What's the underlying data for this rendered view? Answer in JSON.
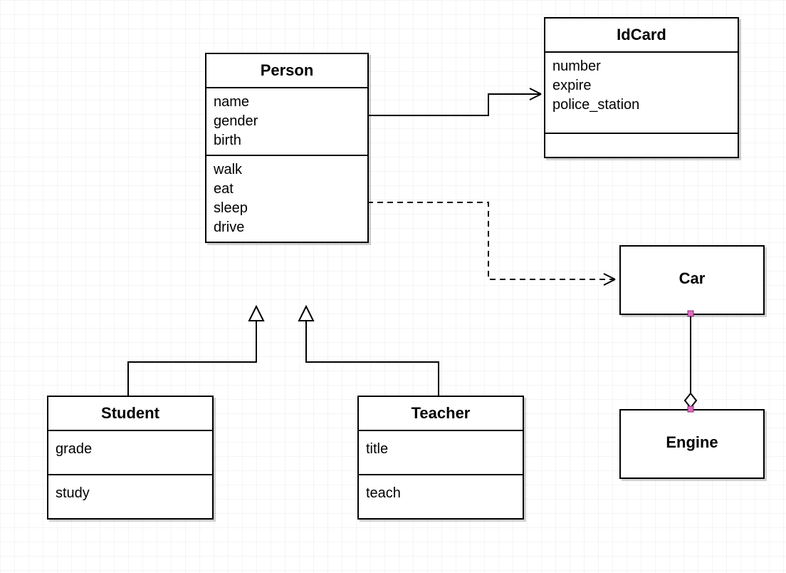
{
  "diagram": {
    "classes": {
      "person": {
        "name": "Person",
        "attributes": [
          "name",
          "gender",
          "birth"
        ],
        "methods": [
          "walk",
          "eat",
          "sleep",
          "drive"
        ]
      },
      "idcard": {
        "name": "IdCard",
        "attributes": [
          "number",
          "expire",
          "police_station"
        ],
        "methods": []
      },
      "student": {
        "name": "Student",
        "attributes": [
          "grade"
        ],
        "methods": [
          "study"
        ]
      },
      "teacher": {
        "name": "Teacher",
        "attributes": [
          "title"
        ],
        "methods": [
          "teach"
        ]
      },
      "car": {
        "name": "Car",
        "attributes": [],
        "methods": []
      },
      "engine": {
        "name": "Engine",
        "attributes": [],
        "methods": []
      }
    },
    "relationships": [
      {
        "from": "Person",
        "to": "IdCard",
        "type": "association-directed"
      },
      {
        "from": "Person",
        "to": "Car",
        "type": "dependency"
      },
      {
        "from": "Student",
        "to": "Person",
        "type": "generalization"
      },
      {
        "from": "Teacher",
        "to": "Person",
        "type": "generalization"
      },
      {
        "from": "Car",
        "to": "Engine",
        "type": "aggregation"
      }
    ]
  }
}
